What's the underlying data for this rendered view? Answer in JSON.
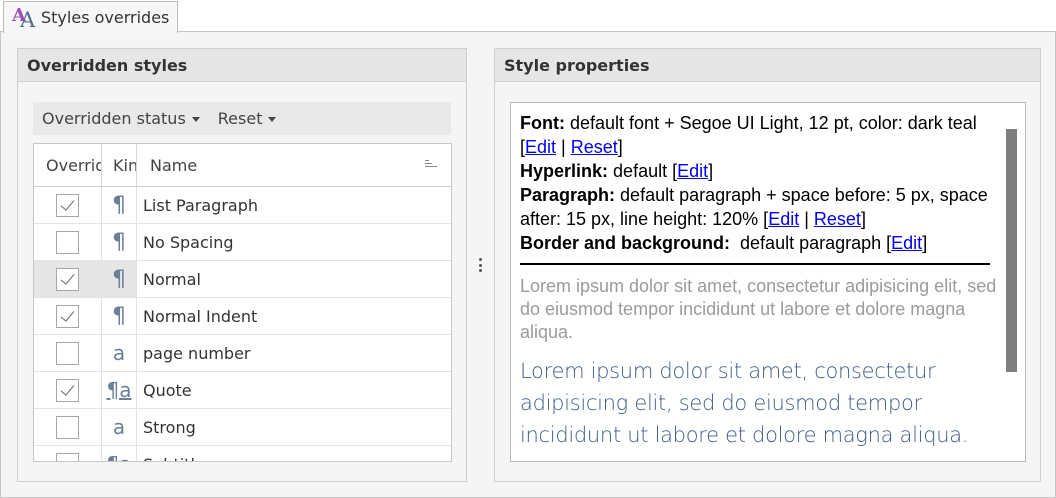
{
  "tab": {
    "label": "Styles overrides",
    "icon": "styles-icon"
  },
  "left_panel": {
    "title": "Overridden styles",
    "toolbar": {
      "status_label": "Overridden status",
      "reset_label": "Reset"
    },
    "columns": {
      "overridden": "Overridden",
      "kind": "Kind",
      "name": "Name"
    },
    "rows": [
      {
        "checked": true,
        "kind": "paragraph",
        "kind_glyph": "¶",
        "name": "List Paragraph",
        "selected": false
      },
      {
        "checked": false,
        "kind": "paragraph",
        "kind_glyph": "¶",
        "name": "No Spacing",
        "selected": false
      },
      {
        "checked": true,
        "kind": "paragraph",
        "kind_glyph": "¶",
        "name": "Normal",
        "selected": true
      },
      {
        "checked": true,
        "kind": "paragraph",
        "kind_glyph": "¶",
        "name": "Normal Indent",
        "selected": false
      },
      {
        "checked": false,
        "kind": "character",
        "kind_glyph": "a",
        "name": "page number",
        "selected": false
      },
      {
        "checked": true,
        "kind": "linked",
        "kind_glyph": "¶a",
        "name": "Quote",
        "selected": false
      },
      {
        "checked": false,
        "kind": "character",
        "kind_glyph": "a",
        "name": "Strong",
        "selected": false
      },
      {
        "checked": false,
        "kind": "linked",
        "kind_glyph": "¶a",
        "name": "Subtitle",
        "selected": false
      }
    ]
  },
  "right_panel": {
    "title": "Style properties",
    "font": {
      "label": "Font:",
      "value": "default font + Segoe UI Light, 12 pt, color: dark teal",
      "edit": "Edit",
      "reset": "Reset"
    },
    "hyperlink": {
      "label": "Hyperlink:",
      "value": "default",
      "edit": "Edit"
    },
    "paragraph": {
      "label": "Paragraph:",
      "value": "default paragraph + space before: 5 px, space after: 15 px, line height: 120%",
      "edit": "Edit",
      "reset": "Reset"
    },
    "border": {
      "label": "Border and background:",
      "value": "default paragraph",
      "edit": "Edit"
    },
    "preview_before": "Lorem ipsum dolor sit amet, consectetur adipisicing elit, sed do eiusmod tempor incididunt ut labore et dolore magna aliqua.",
    "preview_styled": "Lorem ipsum dolor sit amet, consectetur adipisicing elit, sed do eiusmod tempor incididunt ut labore et dolore magna aliqua."
  },
  "colors": {
    "accent_text": "#3e5f87",
    "link": "#0000ee",
    "icon_purple": "#9c4fb5"
  }
}
